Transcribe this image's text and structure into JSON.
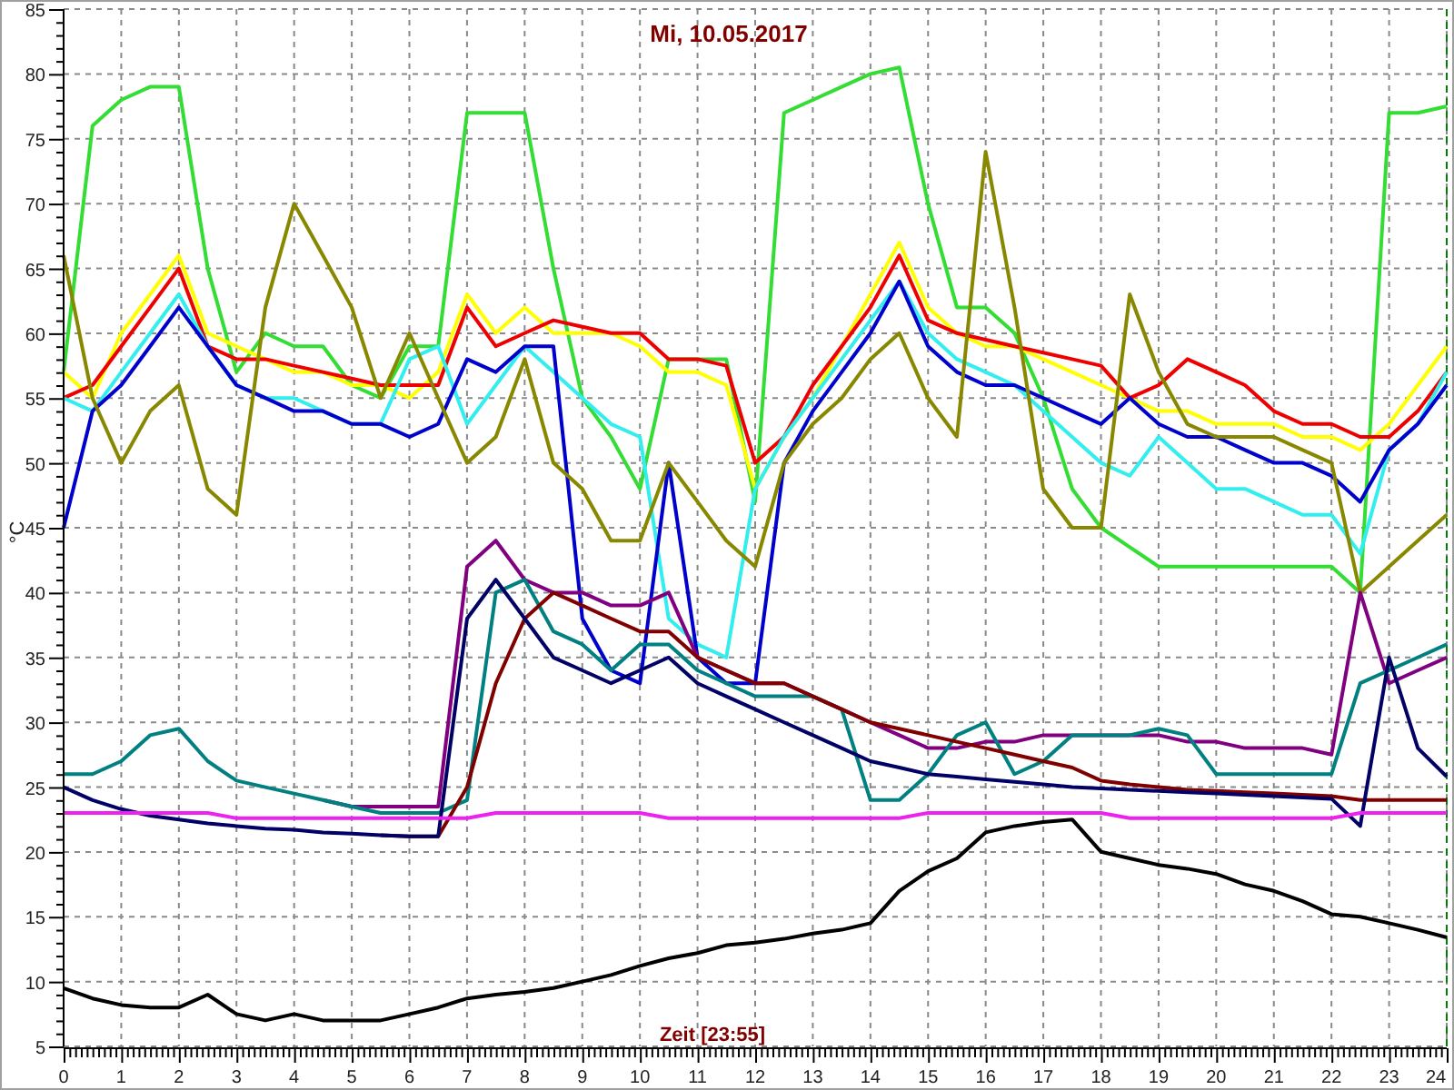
{
  "chart_data": {
    "type": "line",
    "grid": true,
    "title": "Mi, 10.05.2017",
    "xlabel": "Zeit [23:55]",
    "ylabel": "°C",
    "xlim": [
      0,
      24
    ],
    "ylim": [
      5,
      85
    ],
    "xticks": [
      0,
      1,
      2,
      3,
      4,
      5,
      6,
      7,
      8,
      9,
      10,
      11,
      12,
      13,
      14,
      15,
      16,
      17,
      18,
      19,
      20,
      21,
      22,
      23,
      24
    ],
    "yticks": [
      5,
      10,
      15,
      20,
      25,
      30,
      35,
      40,
      45,
      50,
      55,
      60,
      65,
      70,
      75,
      80,
      85
    ],
    "x": [
      0,
      0.5,
      1,
      1.5,
      2,
      2.5,
      3,
      3.5,
      4,
      4.5,
      5,
      5.5,
      6,
      6.5,
      7,
      7.5,
      8,
      8.5,
      9,
      9.5,
      10,
      10.5,
      11,
      11.5,
      12,
      12.5,
      13,
      13.5,
      14,
      14.5,
      15,
      15.5,
      16,
      16.5,
      17,
      17.5,
      18,
      18.5,
      19,
      19.5,
      20,
      20.5,
      21,
      21.5,
      22,
      22.5,
      23,
      23.5,
      24
    ],
    "series": [
      {
        "color": "#33dd33",
        "values": [
          57,
          76,
          78,
          79,
          79,
          65,
          57,
          60,
          59,
          59,
          56,
          55,
          59,
          59,
          77,
          77,
          77,
          65,
          55,
          52,
          48,
          58,
          58,
          58,
          47,
          77,
          78,
          79,
          80,
          80.5,
          70,
          62,
          62,
          60,
          55,
          48,
          45,
          43.5,
          42,
          42,
          42,
          42,
          42,
          42,
          42,
          40,
          77,
          77,
          77.5
        ]
      },
      {
        "color": "#ffff00",
        "values": [
          57,
          55,
          60,
          63,
          66,
          60,
          59,
          58,
          57,
          57,
          56,
          56,
          55,
          57,
          63,
          60,
          62,
          60,
          60,
          60,
          59,
          57,
          57,
          56,
          48,
          52,
          55,
          59,
          63,
          67,
          62,
          60,
          59,
          59,
          58,
          57,
          56,
          55,
          54,
          54,
          53,
          53,
          53,
          52,
          52,
          51,
          53,
          56,
          59
        ]
      },
      {
        "color": "#ee0000",
        "values": [
          55,
          56,
          59,
          62,
          65,
          59,
          58,
          58,
          57.5,
          57,
          56.5,
          56,
          56,
          56,
          62,
          59,
          60,
          61,
          60.5,
          60,
          60,
          58,
          58,
          57.5,
          50,
          52,
          56,
          59,
          62,
          66,
          61,
          60,
          59.5,
          59,
          58.5,
          58,
          57.5,
          55,
          56,
          58,
          57,
          56,
          54,
          53,
          53,
          52,
          52,
          54,
          57
        ]
      },
      {
        "color": "#33eeee",
        "values": [
          55,
          54,
          57,
          60,
          63,
          59,
          56,
          55,
          55,
          54,
          53,
          53,
          58,
          59,
          53,
          56,
          59,
          57,
          55,
          53,
          52,
          38,
          36,
          35,
          48,
          52,
          55,
          58,
          61,
          64,
          60,
          58,
          57,
          56,
          54,
          52,
          50,
          49,
          52,
          50,
          48,
          48,
          47,
          46,
          46,
          43,
          51,
          53,
          57
        ]
      },
      {
        "color": "#0000cc",
        "values": [
          45,
          54,
          56,
          59,
          62,
          59,
          56,
          55,
          54,
          54,
          53,
          53,
          52,
          53,
          58,
          57,
          59,
          59,
          38,
          34,
          33,
          50,
          35,
          33,
          33,
          50,
          54,
          57,
          60,
          64,
          59,
          57,
          56,
          56,
          55,
          54,
          53,
          55,
          53,
          52,
          52,
          51,
          50,
          50,
          49,
          47,
          51,
          53,
          56
        ]
      },
      {
        "color": "#888800",
        "values": [
          66,
          55,
          50,
          54,
          56,
          48,
          46,
          62,
          70,
          66,
          62,
          55,
          60,
          55,
          50,
          52,
          58,
          50,
          48,
          44,
          44,
          50,
          47,
          44,
          42,
          50,
          53,
          55,
          58,
          60,
          55,
          52,
          74,
          62,
          48,
          45,
          45,
          63,
          57,
          53,
          52,
          52,
          52,
          51,
          50,
          40,
          42,
          44,
          46
        ]
      },
      {
        "color": "#800080",
        "values": [
          null,
          null,
          null,
          null,
          null,
          null,
          null,
          null,
          null,
          24,
          23.5,
          23.5,
          23.5,
          23.5,
          42,
          44,
          41,
          40,
          40,
          39,
          39,
          40,
          35,
          34,
          33,
          33,
          32,
          31,
          30,
          29,
          28,
          28,
          28.5,
          28.5,
          29,
          29,
          29,
          29,
          29,
          28.5,
          28.5,
          28,
          28,
          28,
          27.5,
          40,
          33,
          34,
          35
        ]
      },
      {
        "color": "#008080",
        "values": [
          26,
          26,
          27,
          29,
          29.5,
          27,
          25.5,
          25,
          24.5,
          24,
          23.5,
          23,
          23,
          23,
          24,
          40,
          41,
          37,
          36,
          34,
          36,
          36,
          34,
          33,
          32,
          32,
          32,
          31,
          24,
          24,
          26,
          29,
          30,
          26,
          27,
          29,
          29,
          29,
          29.5,
          29,
          26,
          26,
          26,
          26,
          26,
          33,
          34,
          35,
          36
        ]
      },
      {
        "color": "#800000",
        "values": [
          null,
          null,
          null,
          null,
          null,
          null,
          null,
          null,
          null,
          null,
          null,
          21.3,
          21.2,
          21.2,
          25,
          33,
          38,
          40,
          39,
          38,
          37,
          37,
          35,
          34,
          33,
          33,
          32,
          31,
          30,
          29.5,
          29,
          28.5,
          28,
          27.5,
          27,
          26.5,
          25.5,
          25.2,
          25,
          24.8,
          24.7,
          24.6,
          24.5,
          24.4,
          24.3,
          24,
          24,
          24,
          24
        ]
      },
      {
        "color": "#000066",
        "values": [
          25,
          24,
          23.3,
          22.8,
          22.5,
          22.2,
          22,
          21.8,
          21.7,
          21.5,
          21.4,
          21.3,
          21.2,
          21.2,
          38,
          41,
          38,
          35,
          34,
          33,
          34,
          35,
          33,
          32,
          31,
          30,
          29,
          28,
          27,
          26.5,
          26,
          25.8,
          25.6,
          25.4,
          25.2,
          25,
          24.9,
          24.8,
          24.7,
          24.6,
          24.5,
          24.4,
          24.3,
          24.2,
          24.1,
          22,
          35,
          28,
          25.8
        ]
      },
      {
        "color": "#ee22ee",
        "values": [
          23,
          23,
          23,
          23,
          23,
          23,
          22.6,
          22.6,
          22.6,
          22.6,
          22.6,
          22.6,
          22.6,
          22.6,
          22.6,
          23,
          23,
          23,
          23,
          23,
          23,
          22.6,
          22.6,
          22.6,
          22.6,
          22.6,
          22.6,
          22.6,
          22.6,
          22.6,
          23,
          23,
          23,
          23,
          23,
          23,
          23,
          22.6,
          22.6,
          22.6,
          22.6,
          22.6,
          22.6,
          22.6,
          22.6,
          23,
          23,
          23,
          23
        ]
      },
      {
        "color": "#000000",
        "values": [
          9.5,
          8.7,
          8.2,
          8,
          8,
          9,
          7.5,
          7,
          7.5,
          7,
          7,
          7,
          7.5,
          8,
          8.7,
          9,
          9.2,
          9.5,
          10,
          10.5,
          11.2,
          11.8,
          12.2,
          12.8,
          13,
          13.3,
          13.7,
          14,
          14.5,
          17,
          18.5,
          19.5,
          21.5,
          22,
          22.3,
          22.5,
          20,
          19.5,
          19,
          18.7,
          18.3,
          17.5,
          17,
          16.2,
          15.2,
          15,
          14.5,
          14,
          13.4
        ]
      }
    ]
  }
}
